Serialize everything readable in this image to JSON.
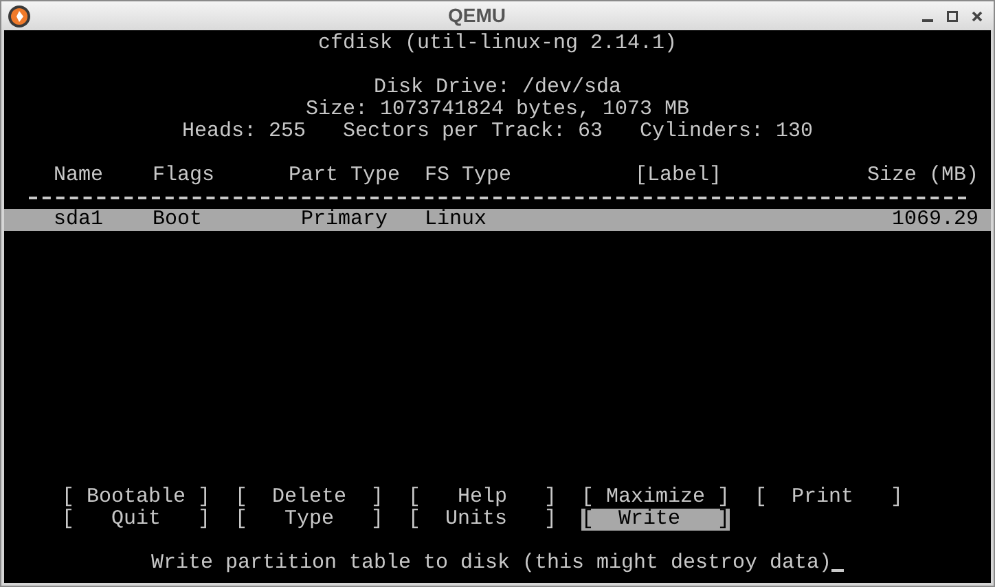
{
  "window": {
    "title": "QEMU"
  },
  "header": {
    "title": "cfdisk (util-linux-ng 2.14.1)",
    "drive": "Disk Drive: /dev/sda",
    "size": "Size: 1073741824 bytes, 1073 MB",
    "geometry": "Heads: 255   Sectors per Track: 63   Cylinders: 130"
  },
  "table": {
    "columns": [
      "Name",
      "Flags",
      "Part Type",
      "FS Type",
      "[Label]",
      "Size (MB)"
    ],
    "rows": [
      {
        "cells": [
          "sda1",
          "Boot",
          "Primary",
          "Linux",
          "",
          "1069.29"
        ],
        "selected": true
      }
    ]
  },
  "menu": [
    {
      "label": "[ Bootable ]",
      "selected": false
    },
    {
      "label": "[  Delete  ]",
      "selected": false
    },
    {
      "label": "[   Help   ]",
      "selected": false
    },
    {
      "label": "[ Maximize ]",
      "selected": false
    },
    {
      "label": "[  Print   ]",
      "selected": false
    },
    {
      "label": "[   Quit   ]",
      "selected": false
    },
    {
      "label": "[   Type   ]",
      "selected": false
    },
    {
      "label": "[  Units   ]",
      "selected": false
    },
    {
      "label": "[  Write   ]",
      "selected": true
    }
  ],
  "status_bar": "Write partition table to disk (this might destroy data)"
}
